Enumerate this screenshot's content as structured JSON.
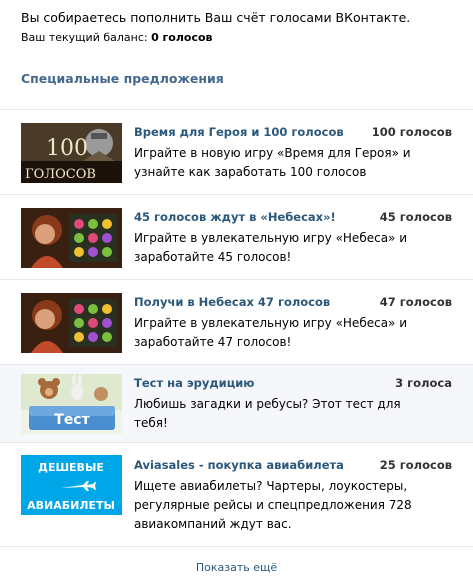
{
  "intro_text": "Вы собираетесь пополнить Ваш счёт голосами ВКонтакте.",
  "balance": {
    "label": "Ваш текущий баланс:",
    "value": "0 голосов"
  },
  "section_title": "Специальные предложения",
  "offers": [
    {
      "title": "Время для Героя и 100 голосов",
      "amount": "100 голосов",
      "description": "Играйте в новую игру «Время для Героя» и узнайте как заработать 100 голосов",
      "thumb_text": [
        "100",
        "ГОЛОСОВ"
      ],
      "thumb_icon": "hero-knight-icon"
    },
    {
      "title": "45 голосов ждут в «Небесах»!",
      "amount": "45 голосов",
      "description": "Играйте в увлекательную игру «Небеса» и заработайте 45 голосов!",
      "thumb_icon": "nebesa-game-icon"
    },
    {
      "title": "Получи в Небесах 47 голосов",
      "amount": "47 голосов",
      "description": "Играйте в увлекательную игру «Небеса» и заработайте 47 голосов!",
      "thumb_icon": "nebesa-game-icon"
    },
    {
      "title": "Тест на эрудицию",
      "amount": "3 голоса",
      "description": "Любишь загадки и ребусы? Этот тест для тебя!",
      "thumb_text": [
        "Тест"
      ],
      "thumb_icon": "quiz-animals-icon"
    },
    {
      "title": "Aviasales - покупка авиабилета",
      "amount": "25 голосов",
      "description": "Ищете авиабилеты? Чартеры, лоукостеры, регулярные рейсы и спецпредложения 728 авиакомпаний ждут вас.",
      "thumb_text": [
        "ДЕШЕВЫЕ",
        "АВИАБИЛЕТЫ"
      ],
      "thumb_icon": "airplane-icon"
    }
  ],
  "show_more_label": "Показать ещё",
  "colors": {
    "link": "#2b587a",
    "section": "#45688e",
    "divider": "#e7e8ec",
    "highlight_bg": "#f6f7fa",
    "aviasales_blue": "#00a7e8"
  }
}
